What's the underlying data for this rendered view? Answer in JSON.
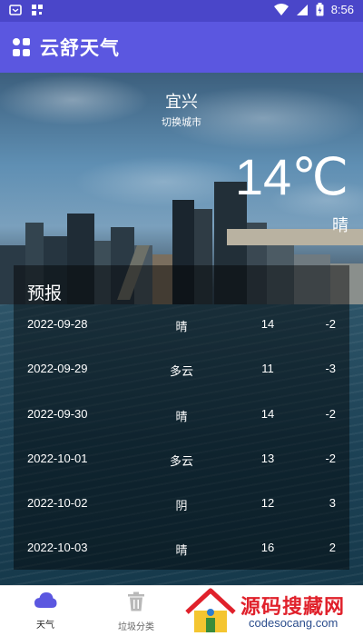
{
  "status_bar": {
    "time": "8:56"
  },
  "app_bar": {
    "title": "云舒天气"
  },
  "weather": {
    "city": "宜兴",
    "switch_city_label": "切换城市",
    "temperature": "14℃",
    "condition": "晴"
  },
  "forecast": {
    "title": "预报",
    "rows": [
      {
        "date": "2022-09-28",
        "condition": "晴",
        "high": "14",
        "low": "-2"
      },
      {
        "date": "2022-09-29",
        "condition": "多云",
        "high": "11",
        "low": "-3"
      },
      {
        "date": "2022-09-30",
        "condition": "晴",
        "high": "14",
        "low": "-2"
      },
      {
        "date": "2022-10-01",
        "condition": "多云",
        "high": "13",
        "low": "-2"
      },
      {
        "date": "2022-10-02",
        "condition": "阴",
        "high": "12",
        "low": "3"
      },
      {
        "date": "2022-10-03",
        "condition": "晴",
        "high": "16",
        "low": "2"
      }
    ]
  },
  "bottom_nav": {
    "items": [
      {
        "label": "天气",
        "icon": "cloud-icon",
        "active": true
      },
      {
        "label": "垃圾分类",
        "icon": "trash-icon",
        "active": false
      }
    ]
  },
  "watermark": {
    "title": "源码搜藏网",
    "subtitle": "codesocang.com"
  },
  "colors": {
    "status_bar": "#4a46c9",
    "app_bar": "#5b57e0",
    "nav_active": "#5b57e0",
    "nav_inactive": "#b8b8b8"
  }
}
